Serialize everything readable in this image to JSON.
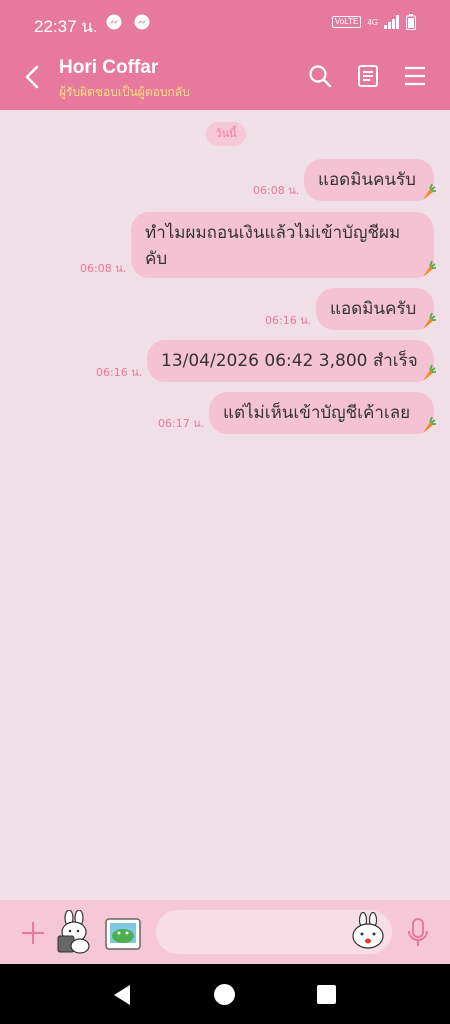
{
  "status_bar": {
    "time": "22:37 น.",
    "volte": "VoLTE",
    "network": "4G"
  },
  "header": {
    "title": "Hori Coffar",
    "subtitle": "ผู้รับผิดชอบเป็นผู้ตอบกลับ"
  },
  "chat": {
    "date_chip": "วันนี้",
    "messages": [
      {
        "text": "แอดมินคนรับ",
        "time": "06:08 น."
      },
      {
        "text": "ทำไมผมถอนเงินแล้วไม่เข้าบัญชีผมคับ",
        "time": "06:08 น."
      },
      {
        "text": "แอดมินครับ",
        "time": "06:16 น."
      },
      {
        "text": "13/04/2026 06:42  3,800 สำเร็จ",
        "time": "06:16 น."
      },
      {
        "text": "แต่ไม่เห็นเข้าบัญชีเค้าเลย",
        "time": "06:17 น."
      }
    ]
  },
  "colors": {
    "header_bg": "#e8799e",
    "bubble_bg": "#f5c2d3",
    "chat_bg": "#f0dfe6",
    "subtitle": "#ffe07a"
  }
}
